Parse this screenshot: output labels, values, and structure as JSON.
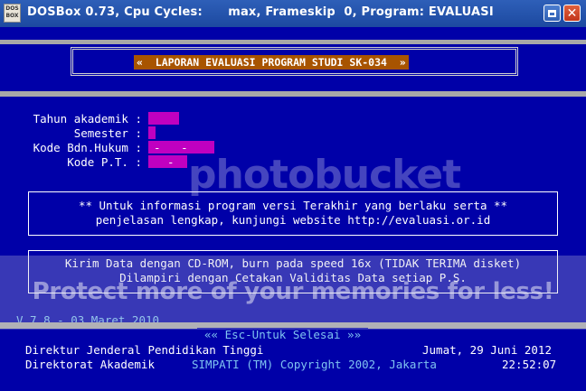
{
  "window": {
    "icon_text": "DOS BOX",
    "title": "DOSBox 0.73, Cpu Cycles:      max, Frameskip  0, Program: EVALUASI",
    "maximize_label": "",
    "close_label": "✕"
  },
  "screen": {
    "header": "«  LAPORAN EVALUASI PROGRAM STUDI SK-034  »",
    "fields": [
      {
        "label": "Tahun akademik :"
      },
      {
        "label": "Semester :"
      },
      {
        "label": "Kode Bdn.Hukum :",
        "value": "-   -"
      },
      {
        "label": "Kode P.T. :",
        "value": "-"
      }
    ],
    "info_box": {
      "line1": "** Untuk informasi program versi Terakhir yang berlaku serta **",
      "line2": "penjelasan lengkap, kunjungi website http://evaluasi.or.id"
    },
    "data_box": {
      "line1": "Kirim Data dengan CD-ROM, burn pada speed 16x (TIDAK TERIMA disket)",
      "line2": "Dilampiri dengan Cetakan Validitas Data setiap P.S."
    },
    "version": "V.7.8 - 03 Maret 2010",
    "esc_label": "«« Esc-Untuk Selesai »»",
    "footer": {
      "left1": "Direktur Jenderal Pendidikan Tinggi",
      "right1": "Jumat, 29 Juni 2012",
      "left2": "Direktorat Akademik",
      "center2": "SIMPATI (TM) Copyright 2002, Jakarta",
      "right2": "22:52:07"
    }
  },
  "watermark": {
    "logo": "photobucket",
    "text": "Protect more of your memories for less!"
  },
  "colors": {
    "dos_blue": "#0000a8",
    "header_orange": "#a85400",
    "magenta": "#c000c0",
    "cyan_text": "#7fc3f0"
  }
}
